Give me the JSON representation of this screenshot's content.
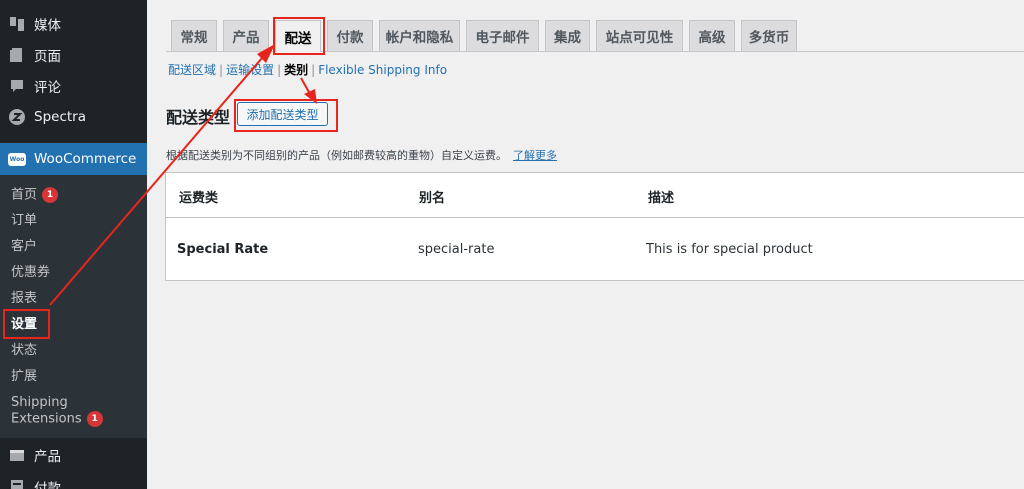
{
  "sidebar": {
    "top_items": [
      {
        "label": "媒体",
        "icon": "media-icon"
      },
      {
        "label": "页面",
        "icon": "page-icon"
      },
      {
        "label": "评论",
        "icon": "comment-icon"
      },
      {
        "label": "Spectra",
        "icon": "spectra-icon"
      }
    ],
    "woocommerce": {
      "label": "WooCommerce",
      "icon_text": "Woo"
    },
    "submenu": [
      {
        "label": "首页",
        "badge": "1"
      },
      {
        "label": "订单"
      },
      {
        "label": "客户"
      },
      {
        "label": "优惠券"
      },
      {
        "label": "报表"
      },
      {
        "label": "设置"
      },
      {
        "label": "状态"
      },
      {
        "label": "扩展"
      },
      {
        "label_line1": "Shipping",
        "label_line2": "Extensions",
        "badge": "1"
      }
    ],
    "bottom_items": [
      {
        "label": "产品",
        "icon": "products-icon"
      },
      {
        "label": "付款",
        "icon": "payments-icon"
      }
    ]
  },
  "tabs": [
    "常规",
    "产品",
    "配送",
    "付款",
    "帐户和隐私",
    "电子邮件",
    "集成",
    "站点可见性",
    "高级",
    "多货币"
  ],
  "active_tab": "配送",
  "sections": {
    "zones": "配送区域",
    "options": "运输设置",
    "classes": "类别",
    "flexible": "Flexible Shipping Info"
  },
  "heading": {
    "title": "配送类型",
    "add_button": "添加配送类型"
  },
  "description": {
    "text": "根据配送类别为不同组别的产品（例如邮费较高的重物）自定义运费。",
    "link": "了解更多"
  },
  "table": {
    "headers": [
      "运费类",
      "别名",
      "描述"
    ],
    "rows": [
      [
        "Special Rate",
        "special-rate",
        "This is for special product"
      ]
    ]
  },
  "colors": {
    "accent": "#2271b1",
    "sidebar_bg": "#1d2327",
    "annotation_red": "#e8251d",
    "badge_red": "#d63638"
  }
}
